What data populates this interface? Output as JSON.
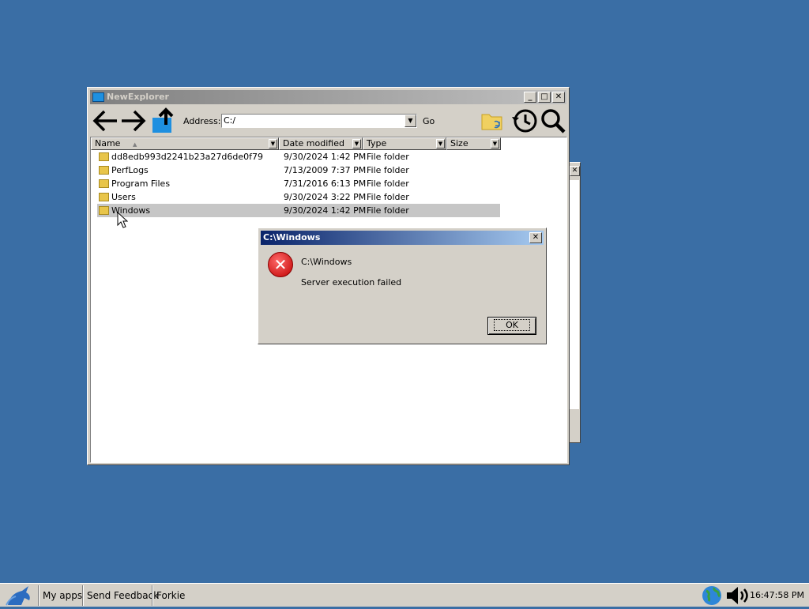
{
  "explorer": {
    "title": "NewExplorer",
    "address_label": "Address:",
    "address_value": "C:/",
    "go_label": "Go",
    "columns": [
      "Name",
      "Date modified",
      "Type",
      "Size"
    ],
    "rows": [
      {
        "name": "dd8edb993d2241b23a27d6de0f79",
        "date": "9/30/2024 1:42 PM",
        "type": "File folder"
      },
      {
        "name": "PerfLogs",
        "date": "7/13/2009 7:37 PM",
        "type": "File folder"
      },
      {
        "name": "Program Files",
        "date": "7/31/2016 6:13 PM",
        "type": "File folder"
      },
      {
        "name": "Users",
        "date": "9/30/2024 3:22 PM",
        "type": "File folder"
      },
      {
        "name": "Windows",
        "date": "9/30/2024 1:42 PM",
        "type": "File folder"
      }
    ]
  },
  "dialog": {
    "title": "C:\\Windows",
    "line1": "C:\\Windows",
    "line2": "Server execution failed",
    "ok_label": "OK"
  },
  "taskbar": {
    "items": [
      "My apps",
      "Send Feedback",
      "Forkie"
    ],
    "clock": "16:47:58 PM"
  }
}
